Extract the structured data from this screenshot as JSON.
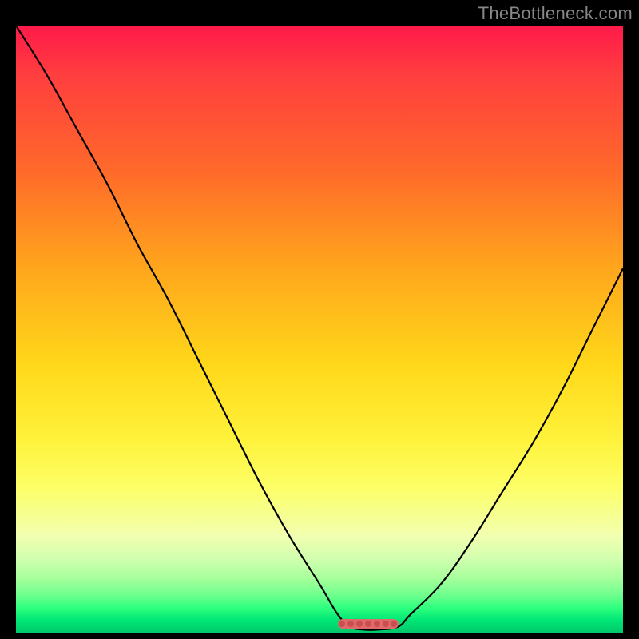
{
  "attribution": "TheBottleneck.com",
  "colors": {
    "curve": "#000000",
    "marker_fill": "#e06a6a",
    "marker_dot": "#c94f4f",
    "bg_black": "#000000"
  },
  "chart_data": {
    "type": "line",
    "title": "",
    "xlabel": "",
    "ylabel": "",
    "xlim": [
      0,
      100
    ],
    "ylim": [
      0,
      100
    ],
    "series": [
      {
        "name": "bottleneck-curve",
        "x": [
          0,
          5,
          10,
          15,
          20,
          25,
          30,
          35,
          40,
          45,
          50,
          53,
          55,
          57,
          60,
          63,
          65,
          70,
          75,
          80,
          85,
          90,
          95,
          100
        ],
        "y": [
          100,
          92,
          83,
          74,
          64,
          55,
          45,
          35,
          25,
          16,
          8,
          3,
          1,
          0.5,
          0.5,
          1,
          3,
          8,
          15,
          23,
          31,
          40,
          50,
          60
        ]
      }
    ],
    "marker": {
      "x_start": 53,
      "x_end": 63,
      "y": 1.5
    },
    "grid": false,
    "legend_position": "none"
  }
}
